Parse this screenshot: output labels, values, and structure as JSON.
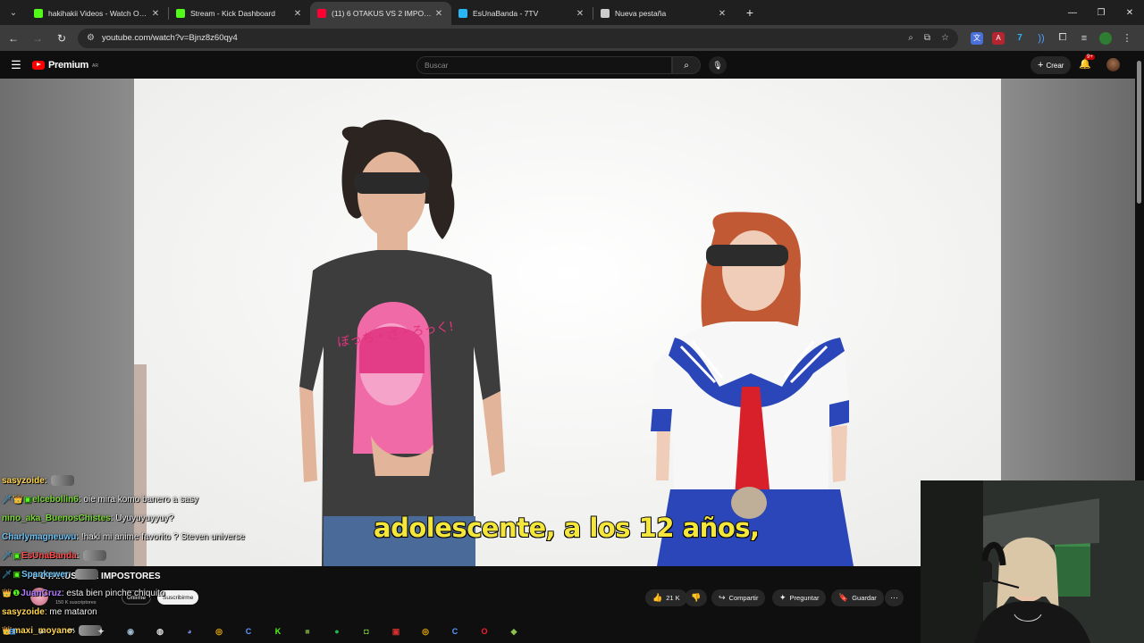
{
  "browser": {
    "tabs": [
      {
        "title": "hakihakii Videos - Watch On-De",
        "favicon": "kick-icon",
        "color": "#53fc18",
        "active": false
      },
      {
        "title": "Stream - Kick Dashboard",
        "favicon": "kick-icon",
        "color": "#53fc18",
        "active": false
      },
      {
        "title": "(11) 6 OTAKUS VS 2 IMPOSTOR",
        "favicon": "youtube-icon",
        "color": "#ff0033",
        "active": true
      },
      {
        "title": "EsUnaBanda - 7TV",
        "favicon": "7tv-icon",
        "color": "#29b6f6",
        "active": false
      },
      {
        "title": "Nueva pestaña",
        "favicon": "chrome-icon",
        "color": "#cccccc",
        "active": false
      }
    ],
    "url": "youtube.com/watch?v=Bjnz8z60qy4"
  },
  "youtube": {
    "logo_text": "Premium",
    "country_code": "AR",
    "search_placeholder": "Buscar",
    "create_label": "Crear",
    "notification_count": "9+",
    "video_title_visible": "6 OTAKUS VS 2 IMPOSTORES",
    "channel_subs": "150 K suscriptores",
    "join_label": "Unirme",
    "subscribe_label": "Suscribirme",
    "likes": "21 K",
    "share_label": "Compartir",
    "ask_label": "Preguntar",
    "save_label": "Guardar"
  },
  "video": {
    "subtitle": "adolescente, a los 12 años,",
    "shirt_text": "ぼっち・ざ・ろっく!"
  },
  "chat": [
    {
      "user": "sasyzoide",
      "color": "#ffd54f",
      "badges": [],
      "message": ""
    },
    {
      "user": "elcebollin6",
      "color": "#7cd93a",
      "badges": [
        "sword-badge",
        "crown-badge",
        "sub-badge"
      ],
      "message": "oie mira komo banero a sasy"
    },
    {
      "user": "nino_aka_BuenosChistes",
      "color": "#7cd93a",
      "badges": [],
      "message": "Uyuyuyuyyuy?"
    },
    {
      "user": "Charlymagneuwu",
      "color": "#6fc3f5",
      "badges": [],
      "message": "!haki mi anime favorito ? Steven universe"
    },
    {
      "user": "EsUnaBanda",
      "color": "#ff4d4d",
      "badges": [
        "sword-badge",
        "sub-badge"
      ],
      "message": ""
    },
    {
      "user": "Spankewer",
      "color": "#6fc3f5",
      "badges": [
        "sword-badge",
        "sub-badge"
      ],
      "message": ""
    },
    {
      "user": "JuanCruz",
      "color": "#b27cff",
      "badges": [
        "crown-badge",
        "gift-badge"
      ],
      "message": "esta bien pinche chiquito"
    },
    {
      "user": "sasyzoide",
      "color": "#ffd54f",
      "badges": [],
      "message": "me mataron"
    },
    {
      "user": "maxi_moyano",
      "color": "#ffd54f",
      "badges": [
        "crown-badge"
      ],
      "message": ""
    }
  ],
  "taskbar": {
    "icons": [
      {
        "name": "windows-start-icon",
        "color": "#4aa3ff",
        "glyph": "⊞"
      },
      {
        "name": "search-icon",
        "color": "#dddddd",
        "glyph": "⌕"
      },
      {
        "name": "headphones-icon",
        "color": "#dddddd",
        "glyph": "◠"
      },
      {
        "name": "ai-icon",
        "color": "#dddddd",
        "glyph": "✦"
      },
      {
        "name": "steam-icon",
        "color": "#9fb8d0",
        "glyph": "◉"
      },
      {
        "name": "obs-icon",
        "color": "#dddddd",
        "glyph": "◍"
      },
      {
        "name": "discord-icon",
        "color": "#7289da",
        "glyph": "◕"
      },
      {
        "name": "chrome-icon",
        "color": "#f4b400",
        "glyph": "◎"
      },
      {
        "name": "c-app-icon",
        "color": "#5a9cff",
        "glyph": "C"
      },
      {
        "name": "kick-icon",
        "color": "#53fc18",
        "glyph": "K"
      },
      {
        "name": "minecraft-icon",
        "color": "#6b8e3a",
        "glyph": "■"
      },
      {
        "name": "spotify-icon",
        "color": "#1db954",
        "glyph": "●"
      },
      {
        "name": "streamlabs-icon",
        "color": "#7fd13b",
        "glyph": "◘"
      },
      {
        "name": "voice-changer-icon",
        "color": "#d32f2f",
        "glyph": "▣"
      },
      {
        "name": "chrome-active-icon",
        "color": "#f4b400",
        "glyph": "◎"
      },
      {
        "name": "c-app-2-icon",
        "color": "#5a9cff",
        "glyph": "C"
      },
      {
        "name": "opera-icon",
        "color": "#ff1b2d",
        "glyph": "O"
      },
      {
        "name": "cube-app-icon",
        "color": "#8bc34a",
        "glyph": "◆"
      }
    ]
  },
  "colors": {
    "yt_red": "#ff0000",
    "subtitle_yellow": "#f4e63a",
    "background": "#0f0f0f"
  }
}
